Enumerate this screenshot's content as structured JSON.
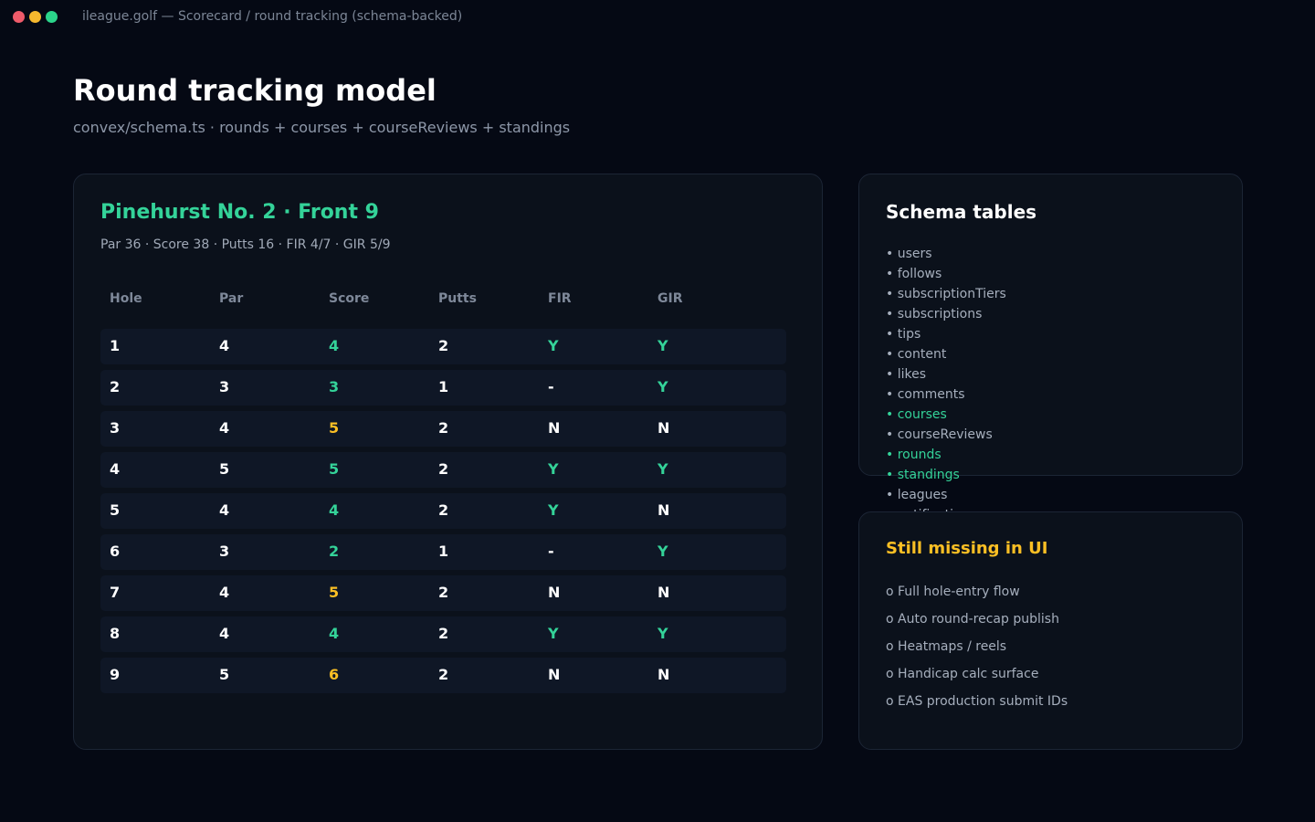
{
  "window": {
    "title": "ileague.golf — Scorecard / round tracking (schema-backed)",
    "dots": [
      "#ef5b6a",
      "#f5b82e",
      "#2bd48a"
    ]
  },
  "page": {
    "title": "Round tracking model",
    "subtitle": "convex/schema.ts · rounds + courses + courseReviews + standings"
  },
  "colors": {
    "accent": "#34d399",
    "warning": "#fbbf24",
    "text": "#ffffff",
    "muted": "#a6afbd"
  },
  "scorecard": {
    "course_title": "Pinehurst No. 2  ·  Front 9",
    "summary": "Par 36  ·  Score 38  ·  Putts 16  ·  FIR 4/7  ·  GIR 5/9",
    "columns": [
      "Hole",
      "Par",
      "Score",
      "Putts",
      "FIR",
      "GIR"
    ],
    "rows": [
      {
        "hole": "1",
        "par": "4",
        "score": "4",
        "putts": "2",
        "fir": "Y",
        "gir": "Y"
      },
      {
        "hole": "2",
        "par": "3",
        "score": "3",
        "putts": "1",
        "fir": "-",
        "gir": "Y"
      },
      {
        "hole": "3",
        "par": "4",
        "score": "5",
        "putts": "2",
        "fir": "N",
        "gir": "N"
      },
      {
        "hole": "4",
        "par": "5",
        "score": "5",
        "putts": "2",
        "fir": "Y",
        "gir": "Y"
      },
      {
        "hole": "5",
        "par": "4",
        "score": "4",
        "putts": "2",
        "fir": "Y",
        "gir": "N"
      },
      {
        "hole": "6",
        "par": "3",
        "score": "2",
        "putts": "1",
        "fir": "-",
        "gir": "Y"
      },
      {
        "hole": "7",
        "par": "4",
        "score": "5",
        "putts": "2",
        "fir": "N",
        "gir": "N"
      },
      {
        "hole": "8",
        "par": "4",
        "score": "4",
        "putts": "2",
        "fir": "Y",
        "gir": "Y"
      },
      {
        "hole": "9",
        "par": "5",
        "score": "6",
        "putts": "2",
        "fir": "N",
        "gir": "N"
      }
    ]
  },
  "schema": {
    "title": "Schema tables",
    "items": [
      {
        "label": "• users",
        "highlight": false
      },
      {
        "label": "• follows",
        "highlight": false
      },
      {
        "label": "• subscriptionTiers",
        "highlight": false
      },
      {
        "label": "• subscriptions",
        "highlight": false
      },
      {
        "label": "• tips",
        "highlight": false
      },
      {
        "label": "• content",
        "highlight": false
      },
      {
        "label": "• likes",
        "highlight": false
      },
      {
        "label": "• comments",
        "highlight": false
      },
      {
        "label": "• courses",
        "highlight": true
      },
      {
        "label": "• courseReviews",
        "highlight": false
      },
      {
        "label": "• rounds",
        "highlight": true
      },
      {
        "label": "• standings",
        "highlight": true
      },
      {
        "label": "• leagues",
        "highlight": false
      },
      {
        "label": "• notifications",
        "highlight": false
      }
    ]
  },
  "missing": {
    "title": "Still missing in UI",
    "items": [
      "o Full hole-entry flow",
      "o Auto round-recap publish",
      "o Heatmaps / reels",
      "o Handicap calc surface",
      "o EAS production submit IDs"
    ]
  }
}
